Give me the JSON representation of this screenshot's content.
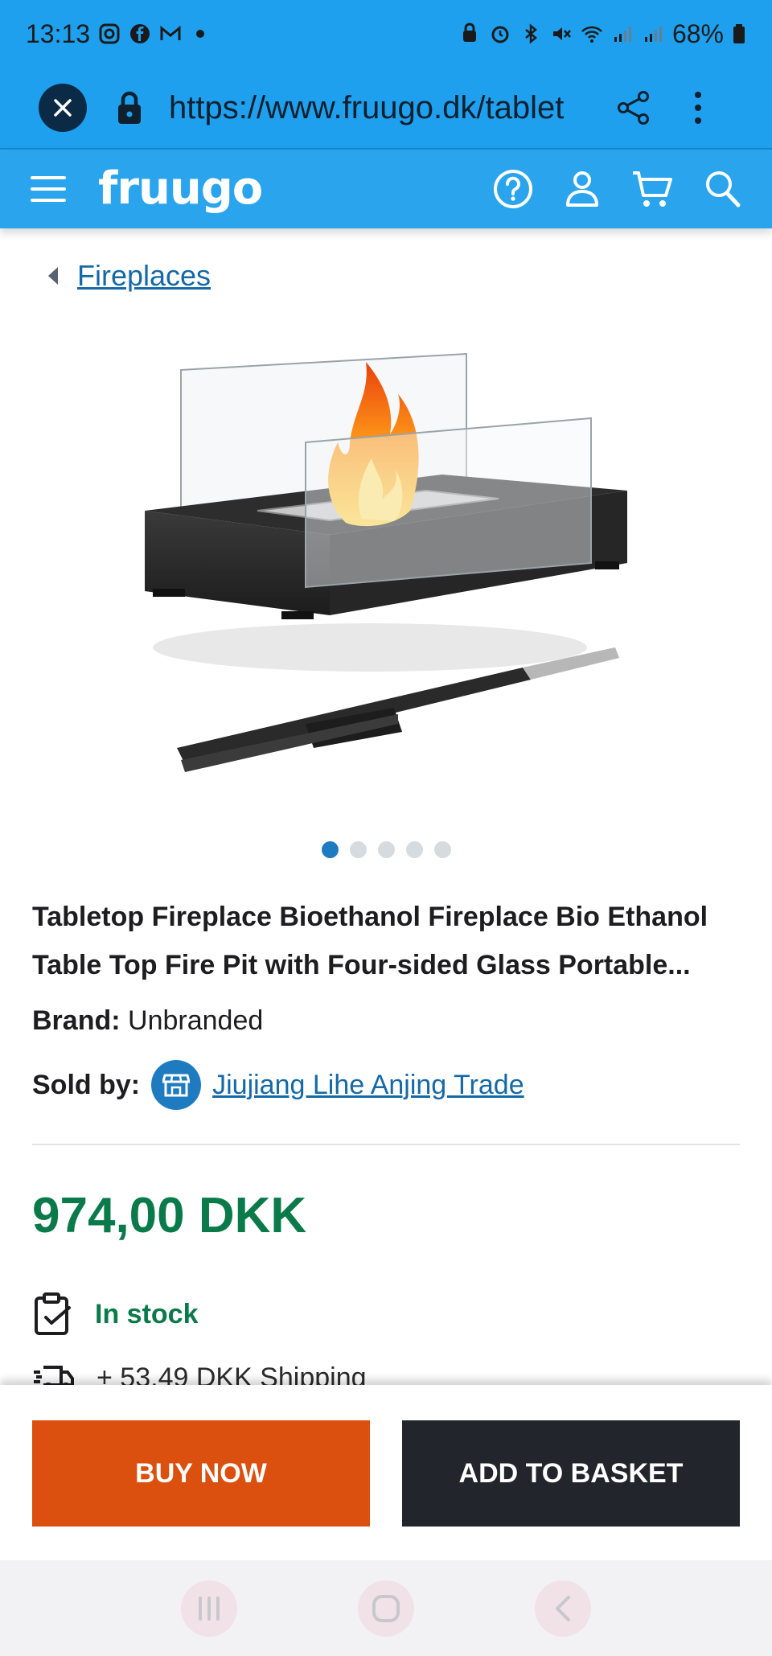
{
  "status_bar": {
    "time": "13:13",
    "battery": "68%"
  },
  "browser": {
    "url": "https://www.fruugo.dk/tablet"
  },
  "site": {
    "logo_text": "fruugo"
  },
  "breadcrumb": {
    "label": "Fireplaces"
  },
  "product": {
    "title": "Tabletop Fireplace Bioethanol Fireplace Bio Ethanol Table Top Fire Pit with Four-sided Glass Portable...",
    "brand_label": "Brand:",
    "brand_value": "Unbranded",
    "sold_by_label": "Sold by:",
    "seller": "Jiujiang Lihe Anjing Trade",
    "price": "974,00 DKK",
    "stock": "In stock",
    "shipping": "+ 53,49 DKK Shipping",
    "image_count": 5,
    "active_image": 1
  },
  "actions": {
    "buy_now": "BUY NOW",
    "add_to_basket": "ADD TO BASKET"
  },
  "colors": {
    "header_blue": "#2aa4ec",
    "price_green": "#0b7a4b",
    "buy_orange": "#db4f0f",
    "basket_dark": "#22252b",
    "link_blue": "#1569a6"
  }
}
